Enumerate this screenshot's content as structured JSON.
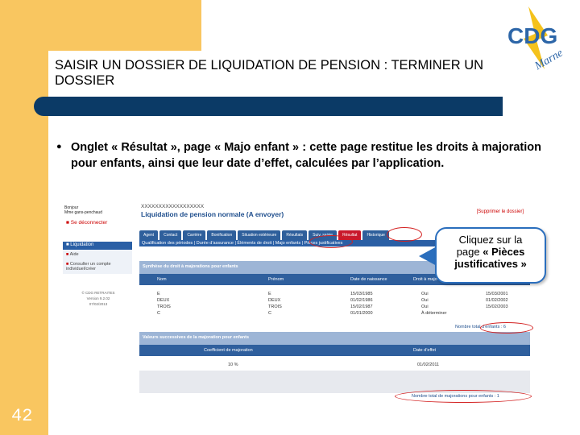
{
  "slide": {
    "title": "SAISIR UN DOSSIER DE LIQUIDATION DE PENSION : TERMINER UN DOSSIER",
    "page_number": "42",
    "logo_text": "CDG",
    "logo_subtext": "Marne",
    "bullet_text": "Onglet « Résultat », page « Majo enfant » : cette page restitue les droits à majoration pour enfants, ainsi que leur date d’effet, calculées par l’application."
  },
  "callout": {
    "line1": "Cliquez sur la",
    "line2": "page ",
    "line2_bold": "« Pièces justificatives »"
  },
  "app": {
    "user_line1": "Bonjour",
    "user_line2": "Mme gans-penchaud",
    "logout": "Se déconnecter",
    "menu_header": "Liquidation",
    "menu_items": [
      "Aide",
      "Consulter un compte individuel/créer"
    ],
    "version_lines": [
      "© CDG RETRAITES",
      "Version 9.2.02",
      "07/02/2013"
    ],
    "record_id": "XXXXXXXXXXXXXXXXXX",
    "record_title": "Liquidation de pension normale (A envoyer)",
    "delete_link": "[Supprimer le dossier]",
    "tabs": [
      "Agent",
      "Contact",
      "Carrière",
      "Bonification",
      "Situation extérieure",
      "Résultats",
      "Suiv. saisie",
      "Résultat",
      "Historique"
    ],
    "active_tab_index": 7,
    "subtabs": "Qualification des périodes | Durée d’assurance | Éléments de droit | Majo enfants | Pièces justificatives",
    "section1_title": "Synthèse du droit à majorations pour enfants",
    "section1_columns": [
      "Nom",
      "Prénom",
      "Date de naissance",
      "Droit à majo"
    ],
    "children": [
      {
        "nom": "E",
        "prenom": "E",
        "naissance": "15/03/1985",
        "droit": "Oui",
        "effet": "15/03/2001"
      },
      {
        "nom": "DEUX",
        "prenom": "DEUX",
        "naissance": "01/02/1986",
        "droit": "Oui",
        "effet": "01/02/2002"
      },
      {
        "nom": "TROIS",
        "prenom": "TROIS",
        "naissance": "15/02/1987",
        "droit": "Oui",
        "effet": "15/02/2003"
      },
      {
        "nom": "C",
        "prenom": "C",
        "naissance": "01/01/2000",
        "droit": "À déterminer",
        "effet": ""
      }
    ],
    "total_children": "Nombre total d’enfants : 6",
    "section2_title": "Valeurs successives de la majoration pour enfants",
    "section2_columns": [
      "Coefficient de majoration",
      "Date d’effet"
    ],
    "majorations": [
      {
        "coef": "10 %",
        "effet": "01/02/2011"
      }
    ],
    "total_majorations": "Nombre total de majorations pour enfants : 1"
  },
  "colors": {
    "accent_yellow": "#f9c660",
    "title_bar": "#0b3a66",
    "app_blue": "#2f5f9d",
    "highlight_red": "#d32020"
  }
}
